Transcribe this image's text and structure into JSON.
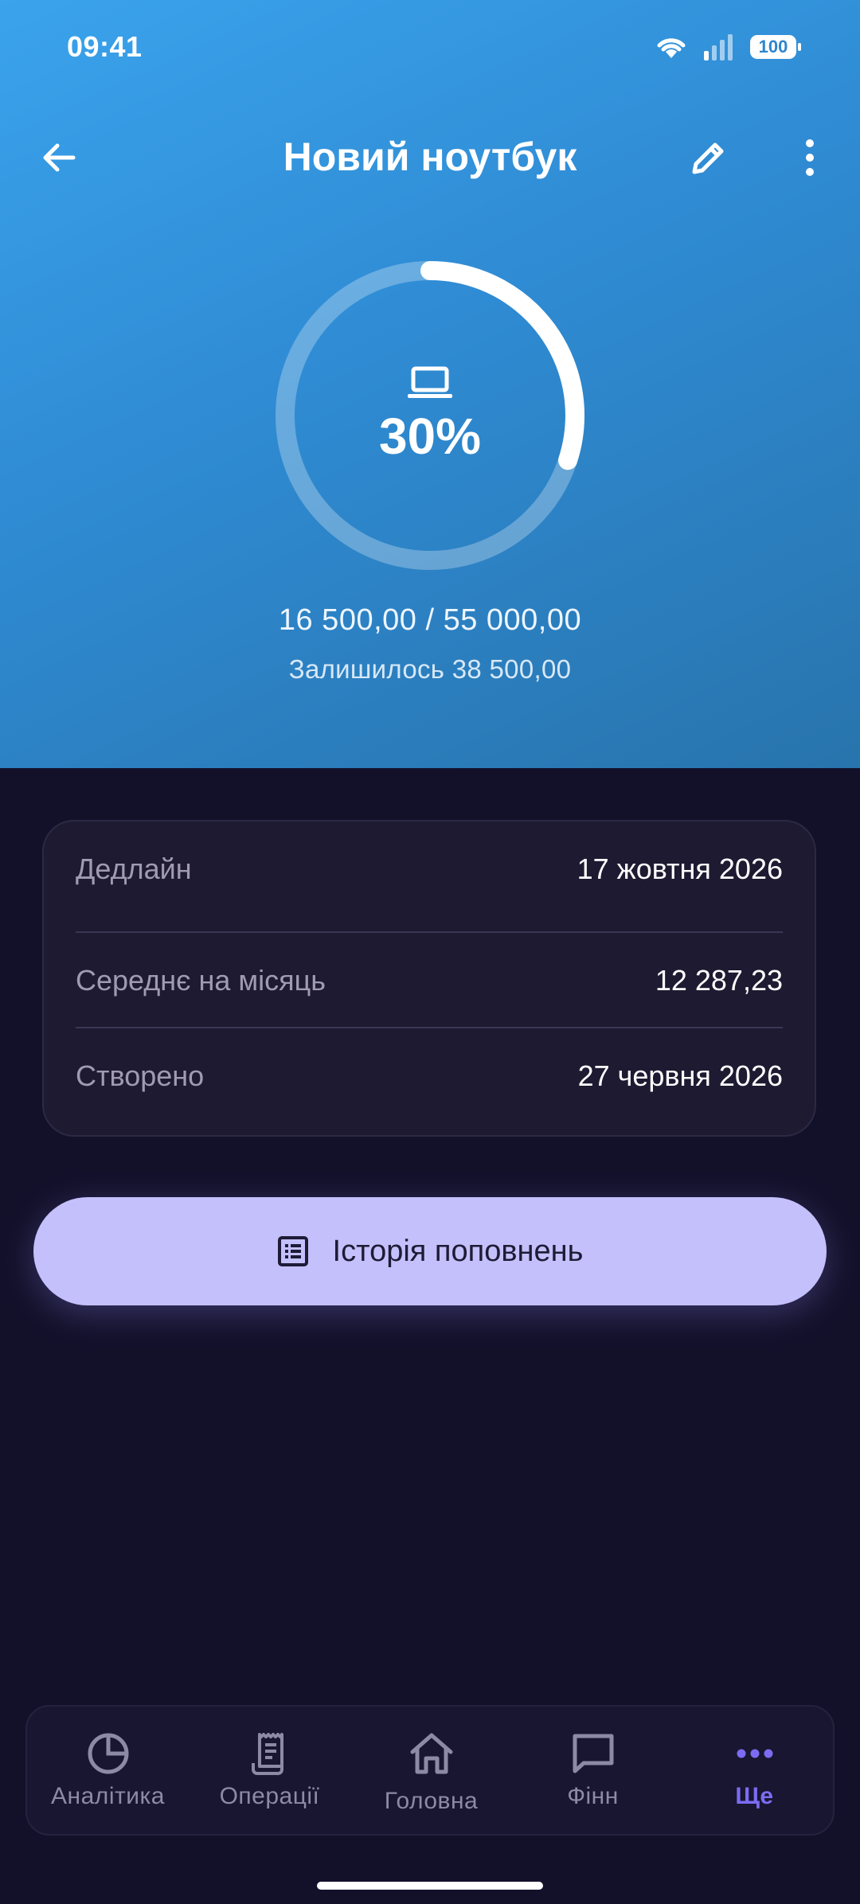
{
  "status_bar": {
    "time": "09:41",
    "battery": "100"
  },
  "topbar": {
    "title": "Новий ноутбук"
  },
  "goal": {
    "progress": 0.3,
    "percent_label": "30%",
    "amounts": "16 500,00 / 55 000,00",
    "remaining": "Залишилось 38 500,00",
    "icon": "laptop-icon"
  },
  "details": [
    {
      "label": "Дедлайн",
      "value": "17 жовтня 2026"
    },
    {
      "label": "Середнє на місяць",
      "value": "12 287,23"
    },
    {
      "label": "Створено",
      "value": "27 червня 2026"
    }
  ],
  "history_button": {
    "label": "Історія поповнень",
    "icon": "list-icon"
  },
  "nav": [
    {
      "label": "Аналітика",
      "icon": "pie-chart-icon",
      "active": false
    },
    {
      "label": "Операції",
      "icon": "receipt-icon",
      "active": false
    },
    {
      "label": "Головна",
      "icon": "home-icon",
      "active": false
    },
    {
      "label": "Фінн",
      "icon": "chat-icon",
      "active": false
    },
    {
      "label": "Ще",
      "icon": "more-dots-icon",
      "active": true
    }
  ],
  "colors": {
    "header_gradient": [
      "#3aa3ec",
      "#2874ad"
    ],
    "background": "#13112a",
    "card": "#1d1a31",
    "button": "#c4c0fb",
    "accent": "#7c6cf2"
  }
}
